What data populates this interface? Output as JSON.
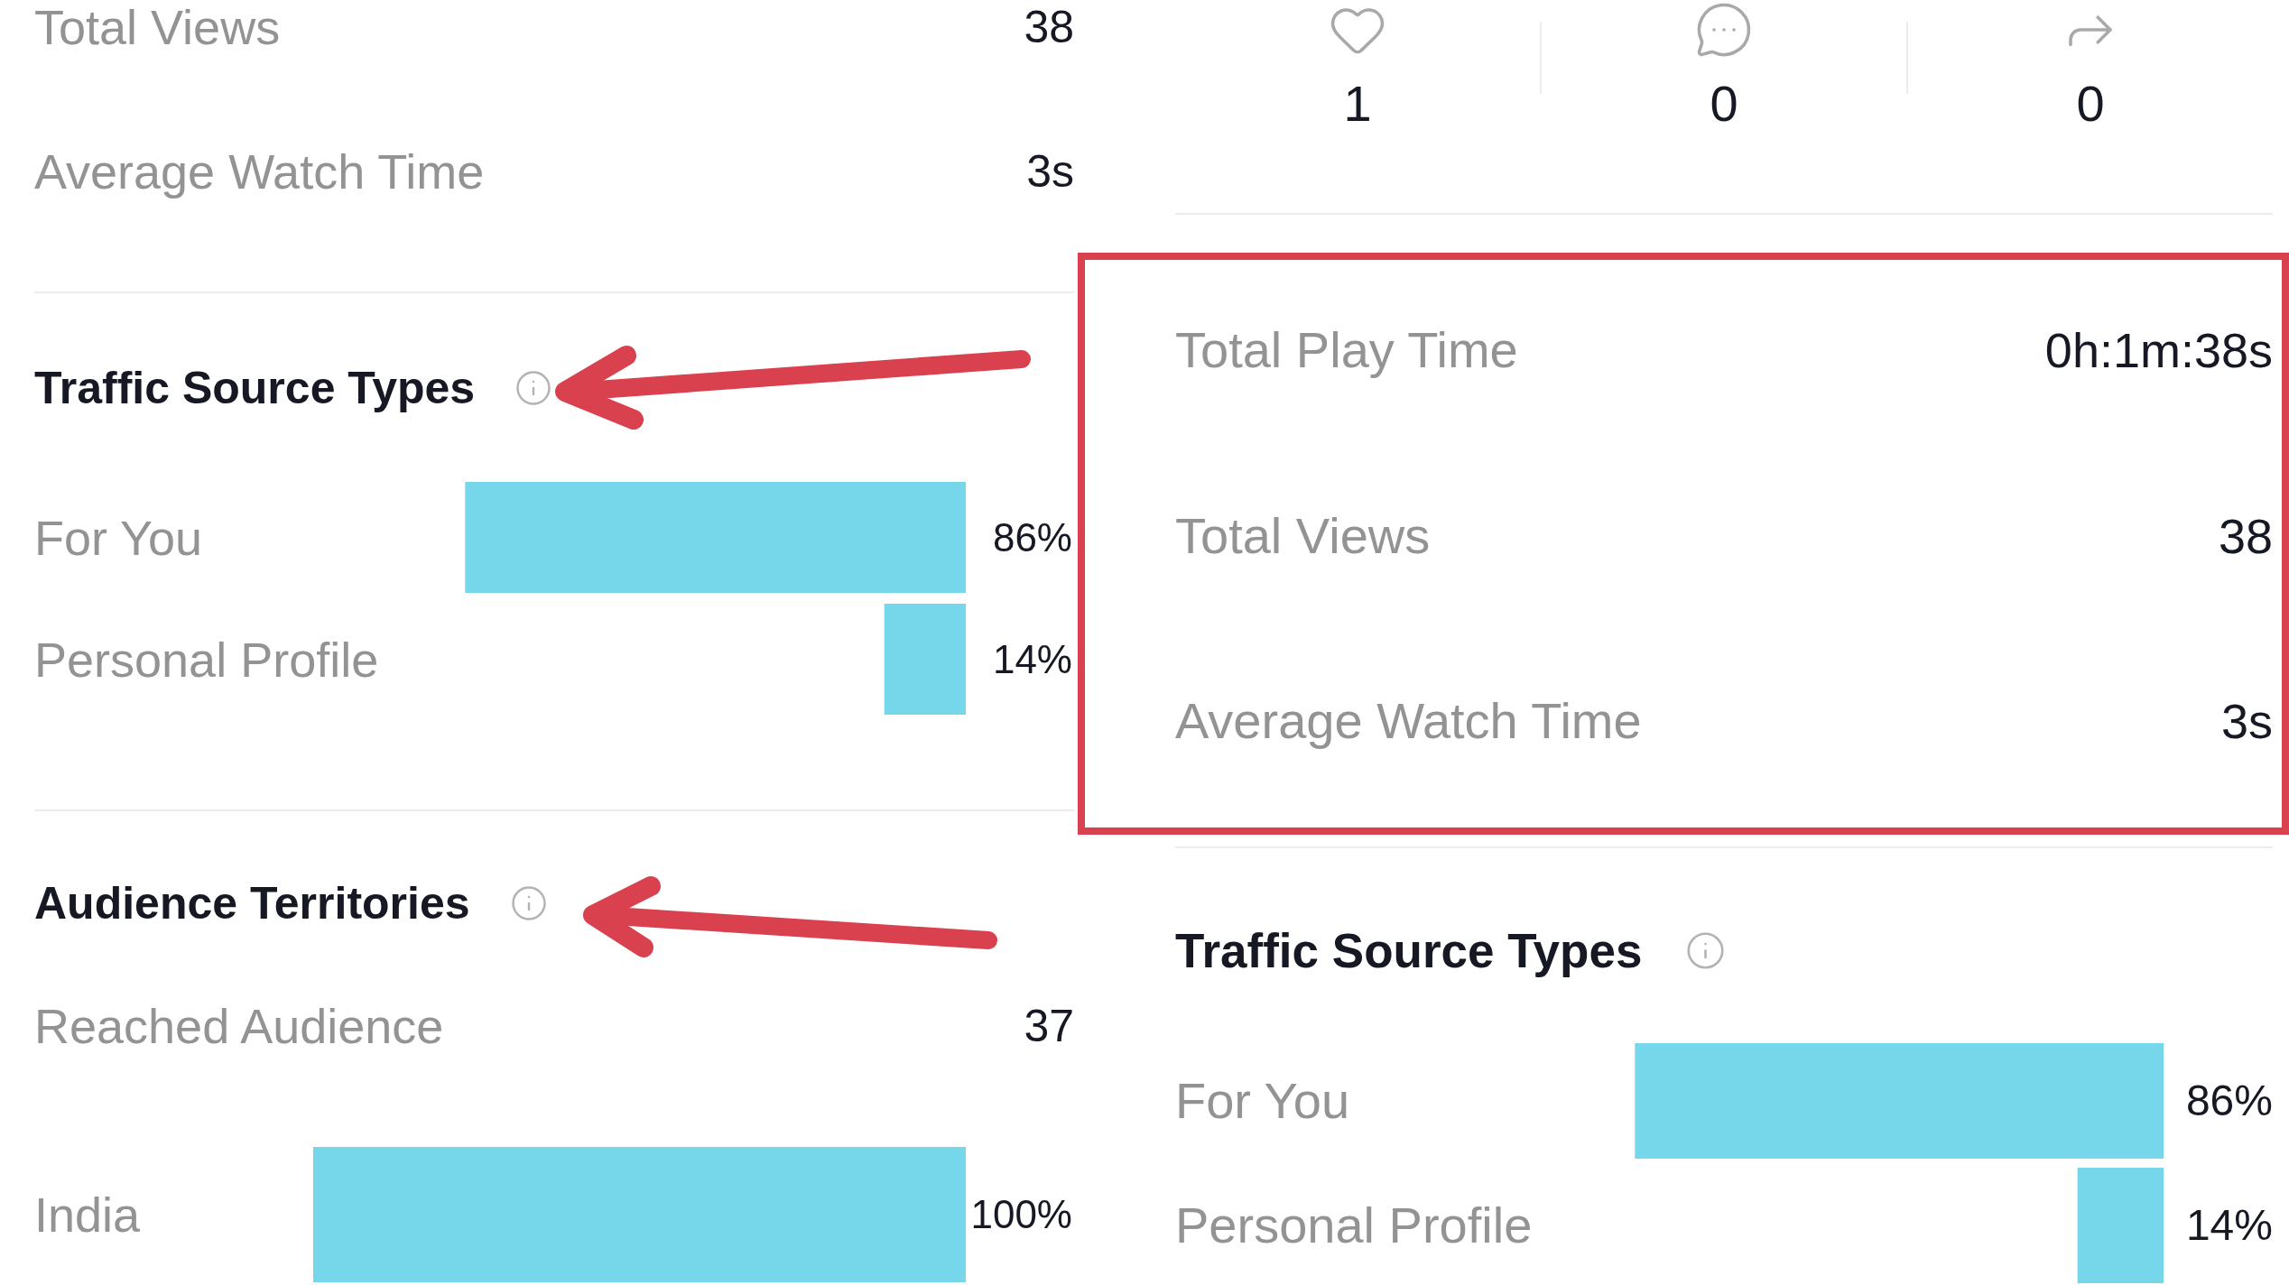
{
  "left_panel": {
    "stats": [
      {
        "label": "Total Views",
        "value": "38"
      },
      {
        "label": "Average Watch Time",
        "value": "3s"
      }
    ],
    "sections": [
      {
        "kind": "traffic",
        "title": "Traffic Source Types",
        "arrow": true,
        "chart_data": {
          "type": "bar",
          "orientation": "horizontal",
          "categories": [
            "For You",
            "Personal Profile"
          ],
          "values": [
            86,
            14
          ],
          "value_labels": [
            "86%",
            "14%"
          ]
        }
      },
      {
        "kind": "territories",
        "title": "Audience Territories",
        "arrow": true,
        "reached": {
          "label": "Reached Audience",
          "value": "37"
        },
        "chart_data": {
          "type": "bar",
          "orientation": "horizontal",
          "categories": [
            "India"
          ],
          "values": [
            100
          ],
          "value_labels": [
            "100%"
          ]
        }
      }
    ]
  },
  "right_panel": {
    "engagement": [
      {
        "kind": "likes",
        "count": "1"
      },
      {
        "kind": "comments",
        "count": "0"
      },
      {
        "kind": "shares",
        "count": "0"
      }
    ],
    "highlighted": true,
    "stats": [
      {
        "label": "Total Play Time",
        "value": "0h:1m:38s"
      },
      {
        "label": "Total Views",
        "value": "38"
      },
      {
        "label": "Average Watch Time",
        "value": "3s"
      }
    ],
    "sections": [
      {
        "kind": "traffic",
        "title": "Traffic Source Types",
        "chart_data": {
          "type": "bar",
          "orientation": "horizontal",
          "categories": [
            "For You",
            "Personal Profile"
          ],
          "values": [
            86,
            14
          ],
          "value_labels": [
            "86%",
            "14%"
          ]
        }
      }
    ]
  }
}
